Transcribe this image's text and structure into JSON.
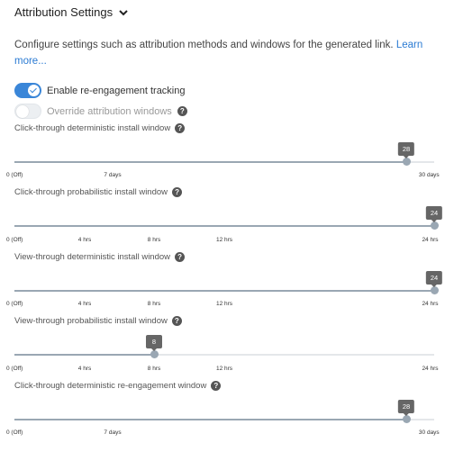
{
  "header": {
    "title": "Attribution Settings",
    "chevron_icon": "chevron-down-icon"
  },
  "description": {
    "text": "Configure settings such as attribution methods and windows for the generated link. ",
    "link": "Learn more..."
  },
  "toggles": [
    {
      "label": "Enable re-engagement tracking",
      "checked": true
    },
    {
      "label": "Override attribution windows",
      "checked": false,
      "help": "?"
    }
  ],
  "sliders": [
    {
      "label": "Click-through deterministic install window",
      "value": "28",
      "position": 0.933,
      "ticks": [
        {
          "label": "0 (Off)",
          "pos": 0
        },
        {
          "label": "7 days",
          "pos": 0.233
        },
        {
          "label": "30 days",
          "pos": 1
        }
      ]
    },
    {
      "label": "Click-through probabilistic install window",
      "value": "24",
      "position": 1.0,
      "ticks": [
        {
          "label": "0 (Off)",
          "pos": 0
        },
        {
          "label": "4 hrs",
          "pos": 0.167
        },
        {
          "label": "8 hrs",
          "pos": 0.333
        },
        {
          "label": "12 hrs",
          "pos": 0.5
        },
        {
          "label": "24 hrs",
          "pos": 1
        }
      ]
    },
    {
      "label": "View-through deterministic install window",
      "value": "24",
      "position": 1.0,
      "ticks": [
        {
          "label": "0 (Off)",
          "pos": 0
        },
        {
          "label": "4 hrs",
          "pos": 0.167
        },
        {
          "label": "8 hrs",
          "pos": 0.333
        },
        {
          "label": "12 hrs",
          "pos": 0.5
        },
        {
          "label": "24 hrs",
          "pos": 1
        }
      ]
    },
    {
      "label": "View-through probabilistic install window",
      "value": "8",
      "position": 0.333,
      "ticks": [
        {
          "label": "0 (Off)",
          "pos": 0
        },
        {
          "label": "4 hrs",
          "pos": 0.167
        },
        {
          "label": "8 hrs",
          "pos": 0.333
        },
        {
          "label": "12 hrs",
          "pos": 0.5
        },
        {
          "label": "24 hrs",
          "pos": 1
        }
      ]
    },
    {
      "label": "Click-through deterministic re-engagement window",
      "value": "28",
      "position": 0.933,
      "ticks": [
        {
          "label": "0 (Off)",
          "pos": 0
        },
        {
          "label": "7 days",
          "pos": 0.233
        },
        {
          "label": "30 days",
          "pos": 1
        }
      ]
    }
  ],
  "help_icon": "?",
  "colors": {
    "accent": "#3a86d8",
    "slider": "#9aa7b3",
    "bubble": "#666666"
  }
}
